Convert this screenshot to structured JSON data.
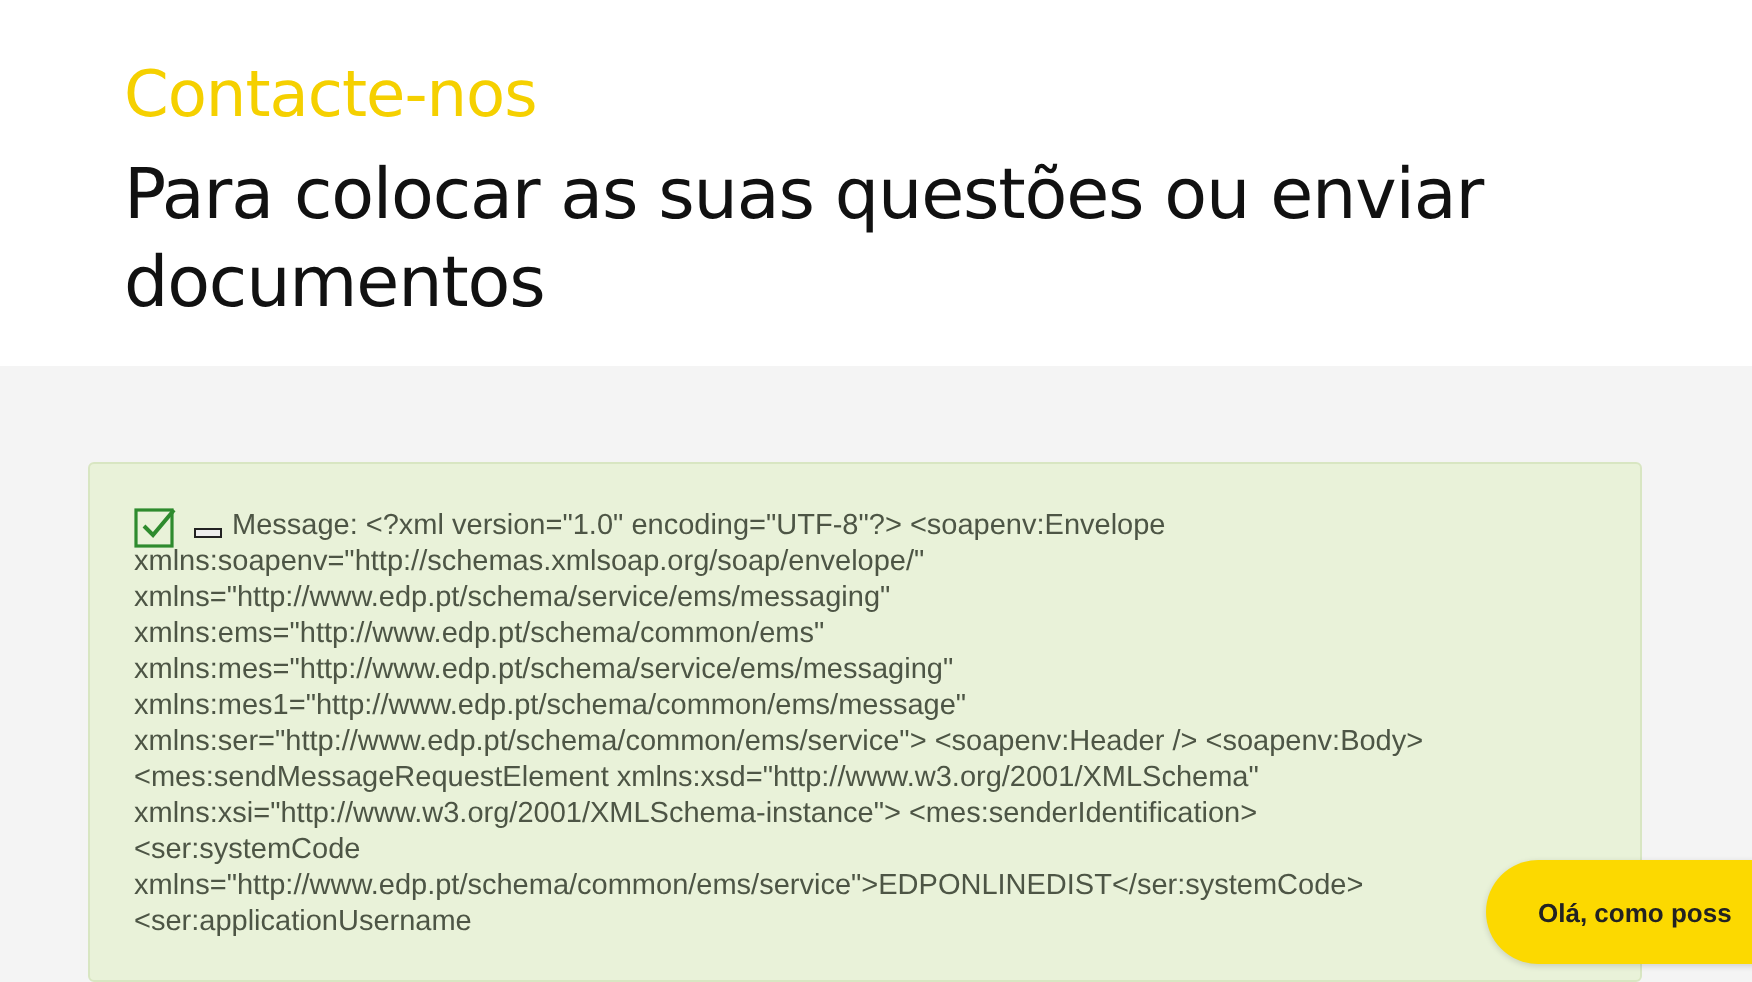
{
  "header": {
    "eyebrow": "Contacte-nos",
    "title": "Para colocar as suas questões ou enviar documentos"
  },
  "message": {
    "checked": true,
    "lines": [
      "Message: <?xml version=\"1.0\" encoding=\"UTF-8\"?> <soapenv:Envelope",
      "xmlns:soapenv=\"http://schemas.xmlsoap.org/soap/envelope/\"",
      "xmlns=\"http://www.edp.pt/schema/service/ems/messaging\"",
      "xmlns:ems=\"http://www.edp.pt/schema/common/ems\"",
      "xmlns:mes=\"http://www.edp.pt/schema/service/ems/messaging\"",
      "xmlns:mes1=\"http://www.edp.pt/schema/common/ems/message\"",
      "xmlns:ser=\"http://www.edp.pt/schema/common/ems/service\"> <soapenv:Header /> <soapenv:Body>",
      "<mes:sendMessageRequestElement xmlns:xsd=\"http://www.w3.org/2001/XMLSchema\"",
      "xmlns:xsi=\"http://www.w3.org/2001/XMLSchema-instance\"> <mes:senderIdentification>",
      "<ser:systemCode",
      "xmlns=\"http://www.edp.pt/schema/common/ems/service\">EDPONLINEDIST</ser:systemCode>",
      "<ser:applicationUsername"
    ]
  },
  "chat": {
    "label": "Olá, como poss"
  }
}
